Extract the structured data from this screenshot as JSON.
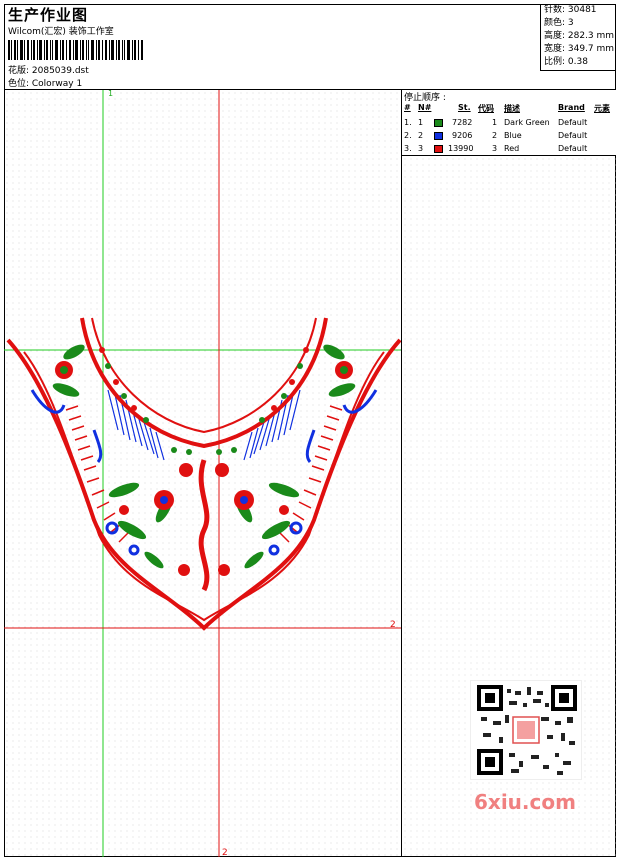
{
  "header": {
    "title": "生产作业图",
    "subtitle": "Wilcom(汇宏) 装饰工作室",
    "design_label": "花版: 2085039.dst",
    "color_label": "色位: Colorway 1"
  },
  "stats": {
    "stitches": "针数: 30481",
    "colors": "颜色: 3",
    "height": "高度: 282.3 mm",
    "width": "宽度: 349.7 mm",
    "scale": "比例: 0.38"
  },
  "stop_sequence": {
    "title": "停止顺序 :",
    "headers": [
      "#",
      "N#",
      "St.",
      "代码",
      "描述",
      "Brand",
      "元素"
    ],
    "rows": [
      {
        "idx": "1.",
        "n": "1",
        "color": "#1a8a1a",
        "st": "7282",
        "code": "1",
        "desc": "Dark Green",
        "brand": "Default"
      },
      {
        "idx": "2.",
        "n": "2",
        "color": "#1030e0",
        "st": "9206",
        "code": "2",
        "desc": "Blue",
        "brand": "Default"
      },
      {
        "idx": "3.",
        "n": "3",
        "color": "#e01010",
        "st": "13990",
        "code": "3",
        "desc": "Red",
        "brand": "Default"
      }
    ]
  },
  "guides": {
    "green_label": "1",
    "red_label_right": "2",
    "red_label_bottom": "2"
  },
  "watermark": {
    "text": "6xiu.com"
  },
  "colors": {
    "red": "#e01010",
    "green": "#1a8a1a",
    "blue": "#1030e0"
  }
}
